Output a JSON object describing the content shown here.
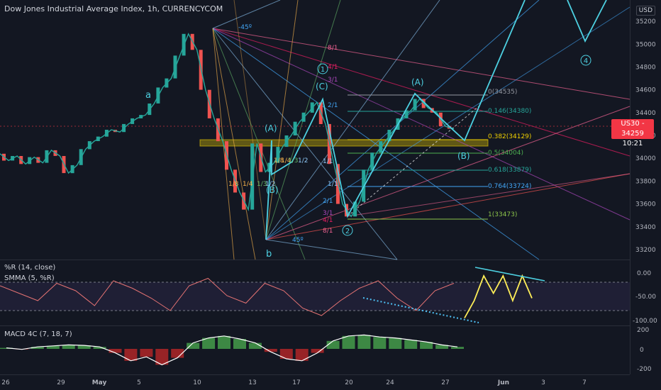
{
  "header": {
    "title": "Dow Jones Industrial Average Index, 1h, CURRENCYCOM"
  },
  "price_axis": {
    "unit": "USD",
    "ticks": [
      "35200",
      "35000",
      "34800",
      "34600",
      "34400",
      "34200",
      "34000",
      "33800",
      "33600",
      "33400",
      "33200"
    ],
    "current_symbol": "US30",
    "current_price": "34259",
    "countdown": "10:21"
  },
  "time_axis": {
    "labels": [
      "26",
      "29",
      "May",
      "5",
      "10",
      "13",
      "17",
      "20",
      "24",
      "27",
      "Jun",
      "3",
      "7"
    ]
  },
  "indicators": {
    "williams": {
      "label1": "%R (14, close)",
      "label2": "SMMA (5, %R)",
      "ticks": [
        "0.00",
        "-50.00",
        "-100.00"
      ]
    },
    "macd": {
      "label": "MACD 4C (7, 18, 7)",
      "ticks": [
        "200",
        "0",
        "-200"
      ]
    }
  },
  "annotations": {
    "wave_a": "a",
    "wave_b": "b",
    "wave_1": "1",
    "wave_2": "2",
    "wave_4": "4",
    "wave_A1": "(A)",
    "wave_B1": "(B)",
    "wave_C": "(C)",
    "wave_A2": "(A)",
    "wave_B2": "(B)",
    "angle_top": "-45º",
    "angle_bottom": "45º",
    "fan_upper": [
      "8/1",
      "4/1",
      "3/1",
      "2/1",
      "1/1"
    ],
    "fan_lower": [
      "2/1",
      "3/1",
      "4/1",
      "8/1"
    ],
    "fan_left": [
      "1/8",
      "1/4",
      "1/3",
      "1/8",
      "1/4",
      "1/3",
      "1/2",
      "1/2",
      "1/1"
    ],
    "fib_levels": [
      "0(34535)",
      "0.146(34380)",
      "0.382(34129)",
      "0.5(34004)",
      "0.618(33879)",
      "0.764(33724)",
      "1(33473)"
    ]
  },
  "chart_data": {
    "type": "line",
    "title": "Dow Jones Industrial Average Index, 1h, CURRENCYCOM",
    "x_dates": [
      "Apr 26",
      "Apr 29",
      "May 3",
      "May 5",
      "May 10",
      "May 13",
      "May 17",
      "May 20",
      "May 24",
      "May 27",
      "Jun 1",
      "Jun 3",
      "Jun 7"
    ],
    "ylim": [
      33150,
      35300
    ],
    "series": [
      {
        "values": [
          34040,
          33980,
          34020,
          33950,
          34010,
          33960,
          34070,
          34020,
          33870,
          33940,
          34080,
          34150,
          34190,
          34250,
          34230,
          34300,
          34350,
          34380,
          34480,
          34620,
          34700,
          34900,
          35090,
          34950,
          34600,
          34350,
          34150,
          33900,
          33700,
          33550,
          34130,
          33880,
          33960,
          34100,
          34200,
          34320,
          34400,
          34490,
          34300,
          33950,
          33600,
          33490,
          33620,
          33900,
          34050,
          34150,
          34250,
          34350,
          34420,
          34520,
          34440,
          34400,
          34280,
          34259
        ]
      }
    ],
    "wave_projection": [
      34259,
      34450,
      34200,
      34800,
      35200,
      35000,
      35300
    ],
    "williams_r": [
      -30,
      -45,
      -60,
      -25,
      -40,
      -70,
      -20,
      -35,
      -55,
      -80,
      -30,
      -15,
      -50,
      -65,
      -25,
      -40,
      -75,
      -90,
      -60,
      -35,
      -20,
      -55,
      -80,
      -40,
      -25
    ],
    "williams_projection": [
      -95,
      -60,
      -10,
      -45,
      -10,
      -60,
      -10,
      -55
    ],
    "macd": [
      10,
      -5,
      20,
      30,
      40,
      35,
      20,
      -40,
      -120,
      -80,
      -160,
      -90,
      60,
      110,
      130,
      100,
      60,
      -30,
      -100,
      -120,
      -40,
      80,
      130,
      140,
      120,
      110,
      90,
      70,
      40,
      20
    ]
  }
}
